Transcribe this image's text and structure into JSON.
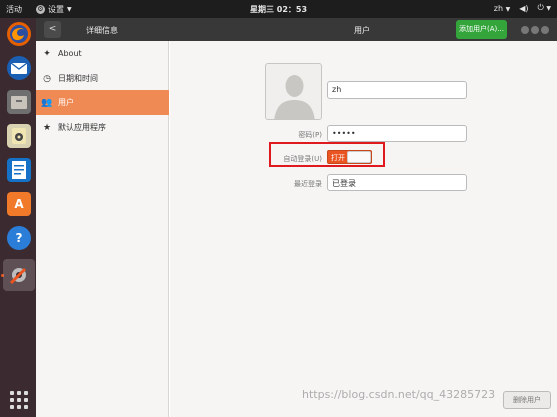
{
  "topbar": {
    "activities": "活动",
    "app_menu": "设置",
    "clock": "星期三 02：53",
    "input_method": "zh"
  },
  "dock": {
    "apps": [
      "firefox-icon",
      "thunderbird-icon",
      "files-icon",
      "rhythmbox-icon",
      "libreoffice-writer-icon",
      "software-center-icon",
      "help-icon",
      "settings-icon"
    ]
  },
  "headerbar": {
    "left_title": "详细信息",
    "center_title": "用户",
    "add_user_label": "添加用户(A)..."
  },
  "sidebar": {
    "items": [
      {
        "label": "About",
        "icon": "star-icon",
        "selected": false
      },
      {
        "label": "日期和时间",
        "icon": "clock-icon",
        "selected": false
      },
      {
        "label": "用户",
        "icon": "users-icon",
        "selected": true
      },
      {
        "label": "默认应用程序",
        "icon": "star-icon",
        "selected": false
      }
    ]
  },
  "user": {
    "name": "zh",
    "password_label": "密码(P)",
    "password_value": "•••••",
    "autologin_label": "自动登录(U)",
    "autologin_state": "打开",
    "last_login_label": "最近登录",
    "last_login_value": "已登录",
    "remove_label": "删除用户"
  },
  "watermark": "https://blog.csdn.net/qq_43285723",
  "colors": {
    "accent": "#e95420",
    "selected_sidebar": "#f08a55",
    "add_button": "#34a53b",
    "highlight_box": "#e0191f"
  }
}
